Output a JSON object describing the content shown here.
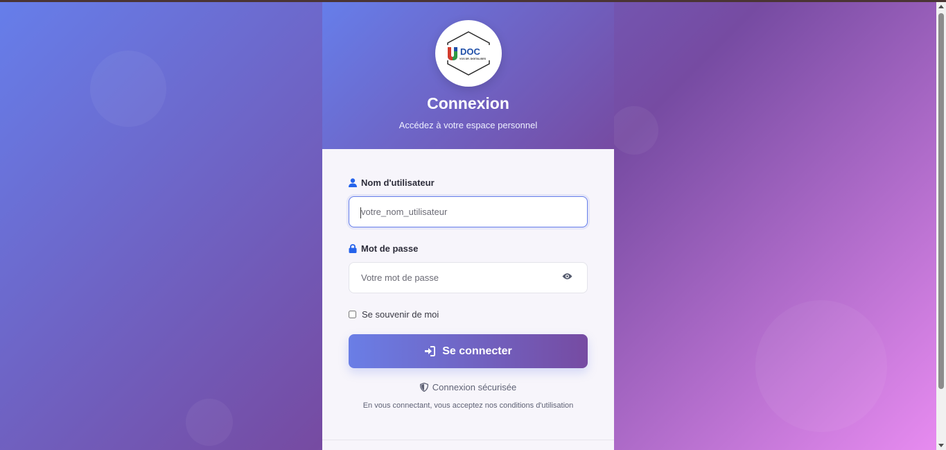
{
  "brand": {
    "logo_text": "DOC",
    "logo_initial": "U",
    "logo_tagline": "VOS DR. DIGITALISES"
  },
  "header": {
    "title": "Connexion",
    "subtitle": "Accédez à votre espace personnel"
  },
  "form": {
    "username": {
      "label": "Nom d'utilisateur",
      "placeholder": "votre_nom_utilisateur",
      "value": ""
    },
    "password": {
      "label": "Mot de passe",
      "placeholder": "Votre mot de passe",
      "value": ""
    },
    "remember": {
      "label": "Se souvenir de moi",
      "checked": false
    },
    "submit_label": "Se connecter"
  },
  "security_note": "Connexion sécurisée",
  "terms": "En vous connectant, vous acceptez nos conditions d'utilisation",
  "colors": {
    "gradient_start": "#667eea",
    "gradient_end": "#764ba2",
    "icon_blue": "#2563eb"
  }
}
